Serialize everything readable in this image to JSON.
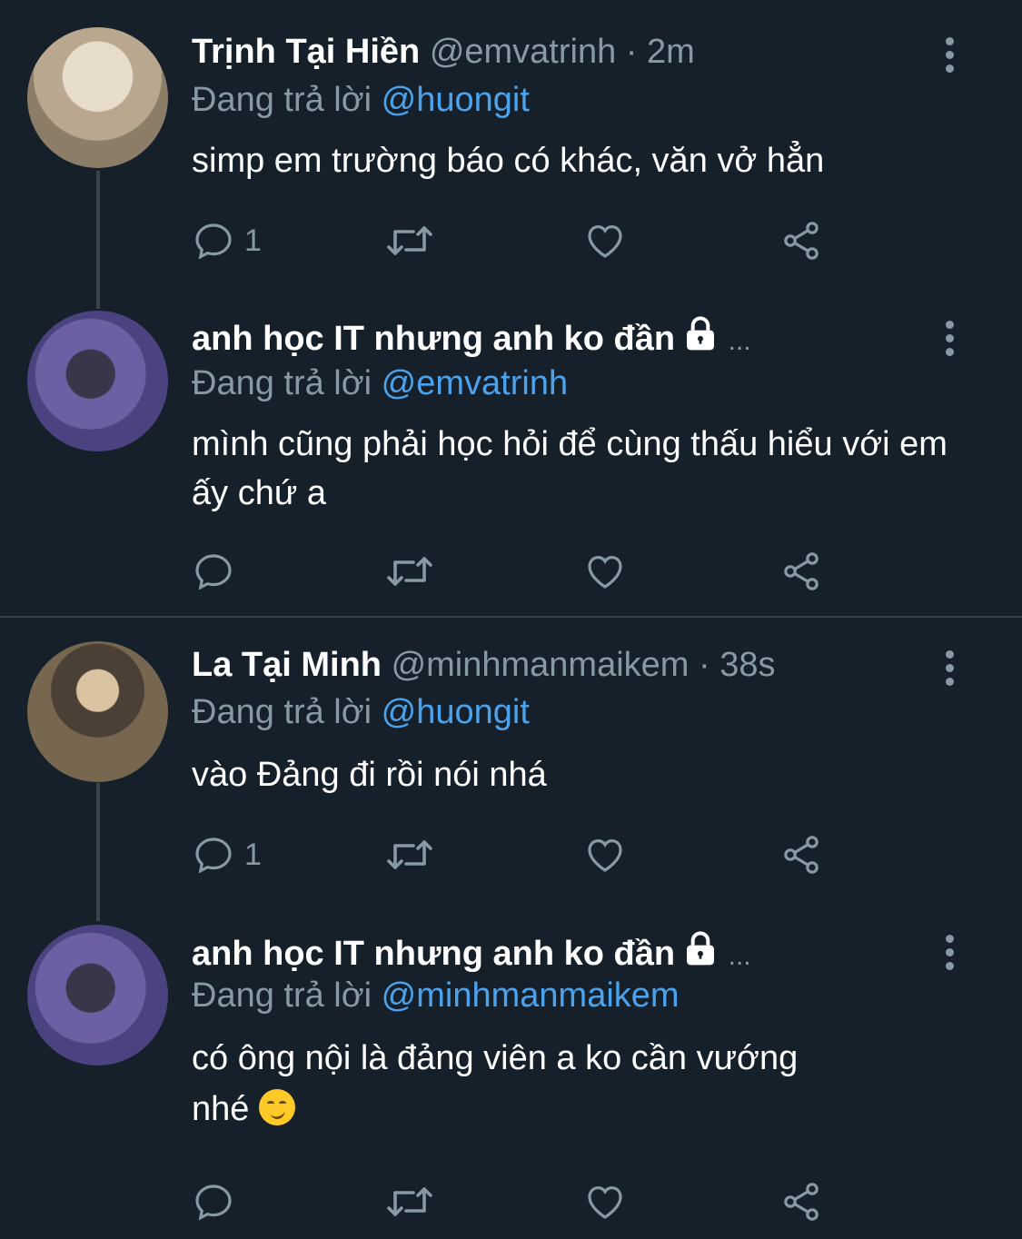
{
  "colors": {
    "background": "#15202b",
    "secondary_text": "#8899a6",
    "accent": "#4aa3ec",
    "divider": "#38444d"
  },
  "tweets": [
    {
      "name": "Trịnh Tại Hiền",
      "handle": "@emvatrinh",
      "time": "· 2m",
      "replying_prefix": "Đang trả lời",
      "replying_to": "@huongit",
      "text": "simp em trường báo có khác, văn vở hẳn",
      "reply_count": "1"
    },
    {
      "name": "anh học IT nhưng anh ko đần",
      "name_suffix": "...",
      "locked": true,
      "replying_prefix": "Đang trả lời",
      "replying_to": "@emvatrinh",
      "text": "mình cũng phải học hỏi để cùng thấu hiểu với em ấy chứ a",
      "reply_count": ""
    },
    {
      "name": "La Tại Minh",
      "handle": "@minhmanmaikem",
      "time": "· 38s",
      "replying_prefix": "Đang trả lời",
      "replying_to": "@huongit",
      "text": "vào Đảng đi rồi nói nhá",
      "reply_count": "1"
    },
    {
      "name": "anh học IT nhưng anh ko đần",
      "name_suffix": "...",
      "locked": true,
      "replying_prefix": "Đang trả lời",
      "replying_to": "@minhmanmaikem",
      "text_line1": "có ông nội là đảng viên a ko cần vướng",
      "text_line2": "nhé",
      "emoji": "smirking-face",
      "reply_count": ""
    }
  ],
  "icons": {
    "reply": "reply-icon",
    "retweet": "retweet-icon",
    "like": "heart-icon",
    "share": "share-icon",
    "more": "more-vertical-icon",
    "lock": "lock-icon"
  }
}
